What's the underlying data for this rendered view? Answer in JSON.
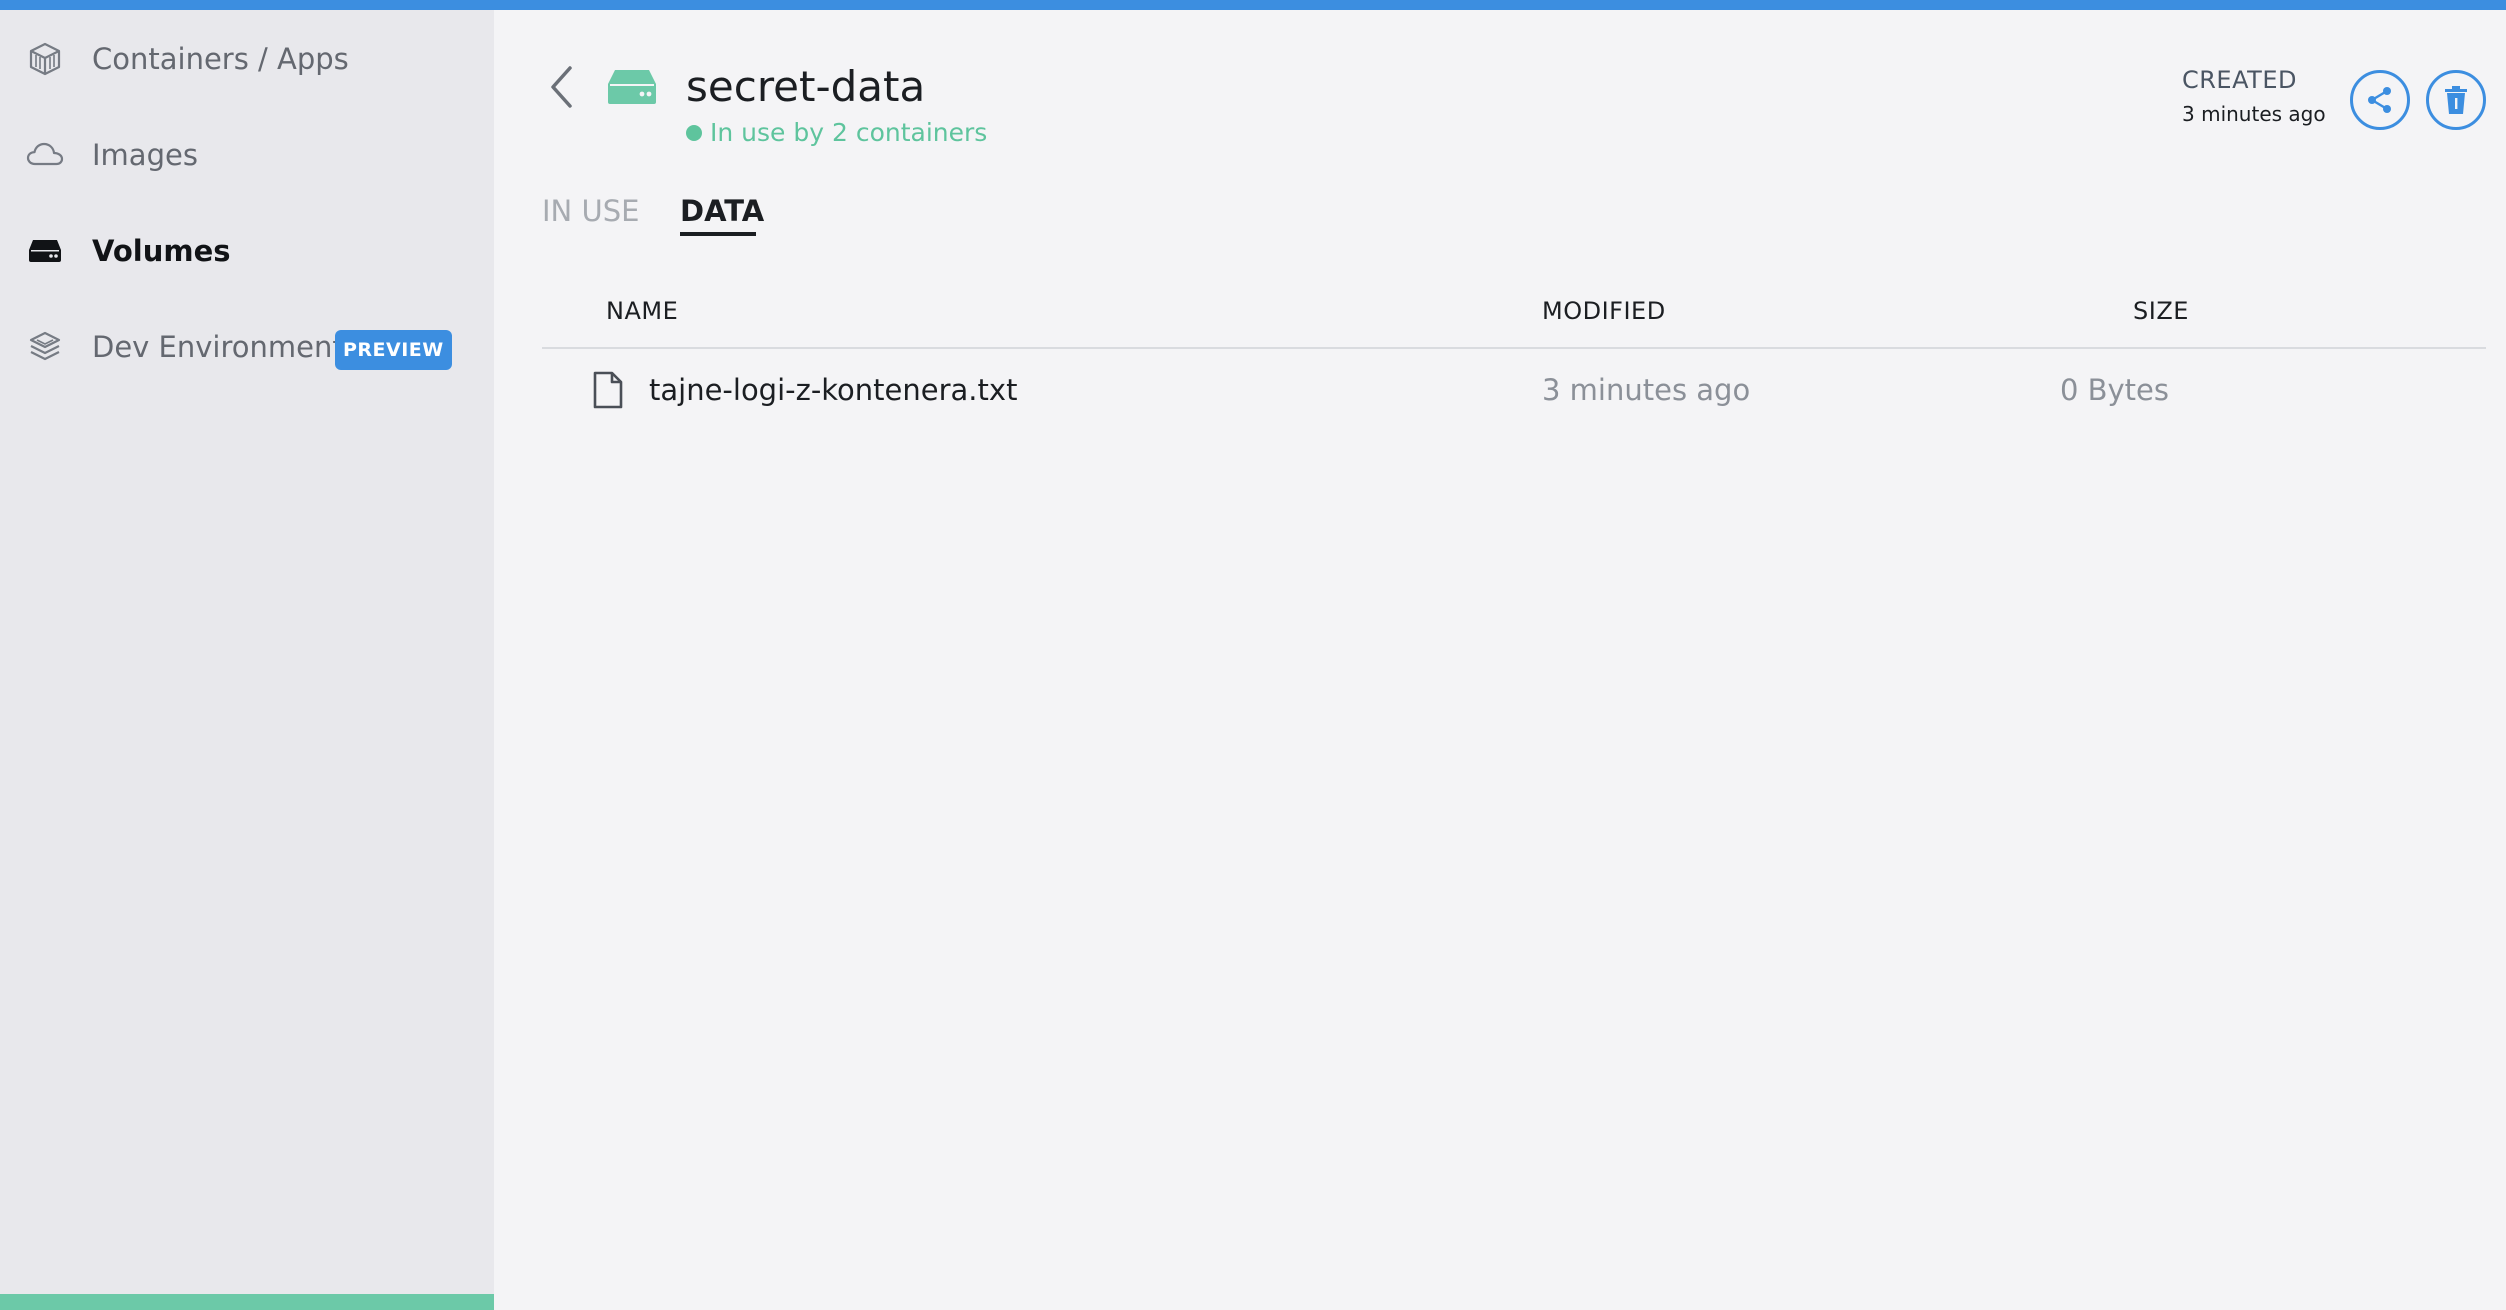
{
  "sidebar": {
    "items": [
      {
        "label": "Containers / Apps",
        "icon": "container-cube-icon",
        "active": false
      },
      {
        "label": "Images",
        "icon": "cloud-icon",
        "active": false
      },
      {
        "label": "Volumes",
        "icon": "hard-drive-icon",
        "active": true
      },
      {
        "label": "Dev Environments",
        "icon": "layers-cube-icon",
        "active": false,
        "badge": "PREVIEW"
      }
    ]
  },
  "volume": {
    "name": "secret-data",
    "status": "In use by 2 containers",
    "created_label": "CREATED",
    "created_value": "3 minutes ago"
  },
  "actions": {
    "share_icon": "share-icon",
    "delete_icon": "trash-icon"
  },
  "tabs": [
    {
      "label": "IN USE",
      "active": false
    },
    {
      "label": "DATA",
      "active": true
    }
  ],
  "table": {
    "columns": [
      "NAME",
      "MODIFIED",
      "SIZE"
    ],
    "rows": [
      {
        "icon": "file-icon",
        "name": "tajne-logi-z-kontenera.txt",
        "modified": "3 minutes ago",
        "size": "0 Bytes"
      }
    ]
  },
  "colors": {
    "accent": "#3c8ee0",
    "status_green": "#5ec49d",
    "sidebar_bg": "#e8e8ec",
    "main_bg": "#f4f4f6"
  }
}
